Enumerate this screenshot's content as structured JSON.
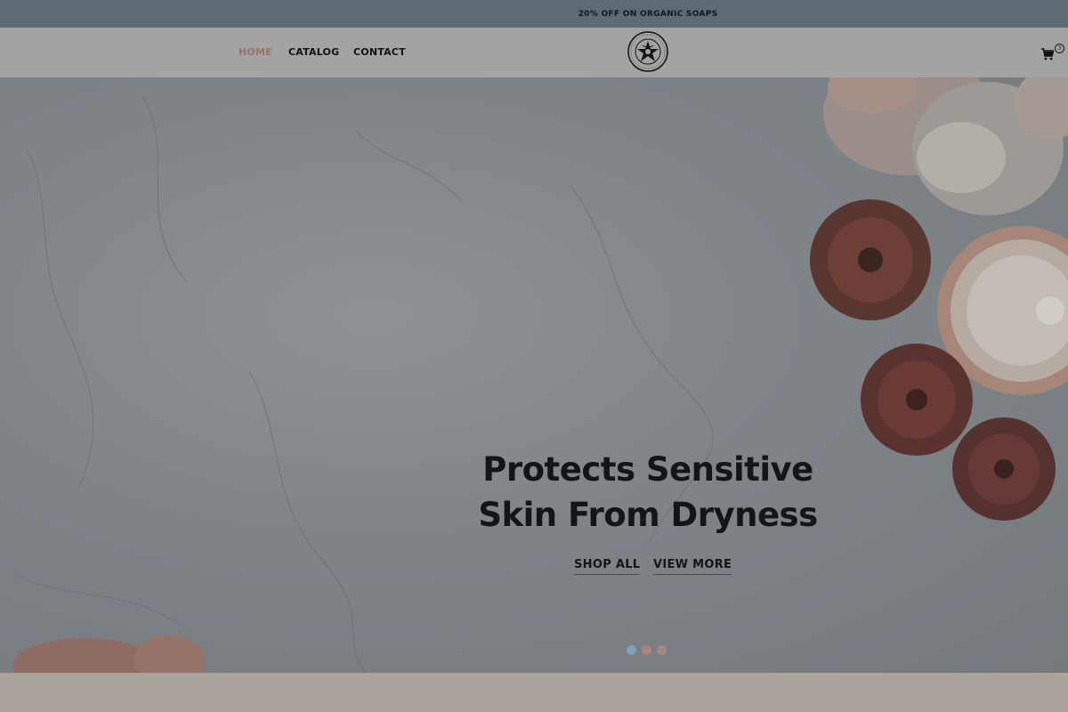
{
  "promo": {
    "text": "20% OFF ON ORGANIC SOAPS"
  },
  "nav": {
    "links": [
      {
        "label": "HOME",
        "active": true
      },
      {
        "label": "CATALOG",
        "active": false
      },
      {
        "label": "CONTACT",
        "active": false
      }
    ],
    "logo_icon": "seal-logo-icon",
    "cart_icon": "shopping-cart-icon",
    "cart_count": "3"
  },
  "hero": {
    "title_line1": "Protects Sensitive",
    "title_line2": "Skin From Dryness",
    "shop_all_label": "SHOP ALL",
    "view_more_label": "VIEW MORE",
    "slide_count": 3,
    "active_slide": 1,
    "dot_colors": [
      "#7fa2b6",
      "#a7857d",
      "#a58680"
    ]
  },
  "colors": {
    "promo_bg": "#5f6b74",
    "nav_bg": "#a3a3a3",
    "active_link": "#9a7268",
    "text_dark": "#131516"
  }
}
